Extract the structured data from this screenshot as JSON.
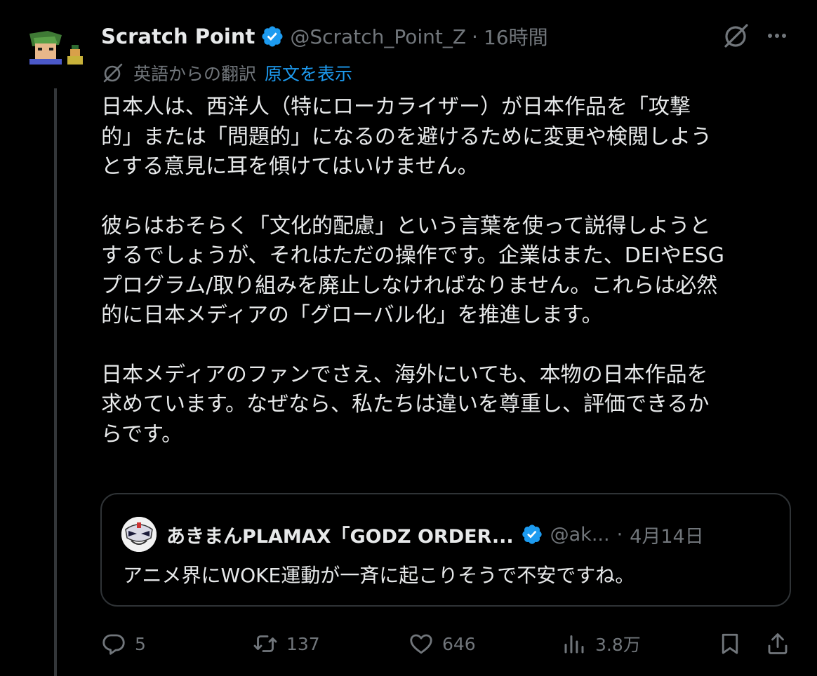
{
  "tweet": {
    "author_name": "Scratch Point",
    "handle": "@Scratch_Point_Z",
    "separator": "·",
    "time": "16時間",
    "translate_label": "英語からの翻訳",
    "show_original": "原文を表示",
    "paragraphs": [
      [
        "日本人は、西洋人（特にローカライザー）が日本作品を「攻撃",
        "的」または「問題的」になるのを避けるために変更や検閲しよう",
        "とする意見に耳を傾けてはいけません。"
      ],
      [
        "彼らはおそらく「文化的配慮」という言葉を使って説得しようと",
        "するでしょうが、それはただの操作です。企業はまた、DEIやESG",
        "プログラム/取り組みを廃止しなければなりません。これらは必然",
        "的に日本メディアの「グローバル化」を推進します。"
      ],
      [
        "日本メディアのファンでさえ、海外にいても、本物の日本作品を",
        "求めています。なぜなら、私たちは違いを尊重し、評価できるか",
        "らです。"
      ]
    ]
  },
  "quote": {
    "author_name": "あきまんPLAMAX「GODZ ORDER...",
    "handle": "@ak...",
    "separator": "·",
    "date": "4月14日",
    "text": "アニメ界にWOKE運動が一斉に起こりそうで不安ですね。"
  },
  "actions": {
    "replies": "5",
    "reposts": "137",
    "likes": "646",
    "views": "3.8万"
  },
  "colors": {
    "background": "#000000",
    "text": "#e7e9ea",
    "muted": "#71767b",
    "accent": "#1d9bf0",
    "border": "#2f3336"
  },
  "icons": [
    "verified-badge-icon",
    "grok-icon",
    "more-icon",
    "translate-icon",
    "reply-icon",
    "repost-icon",
    "like-icon",
    "views-icon",
    "bookmark-icon",
    "share-icon"
  ]
}
